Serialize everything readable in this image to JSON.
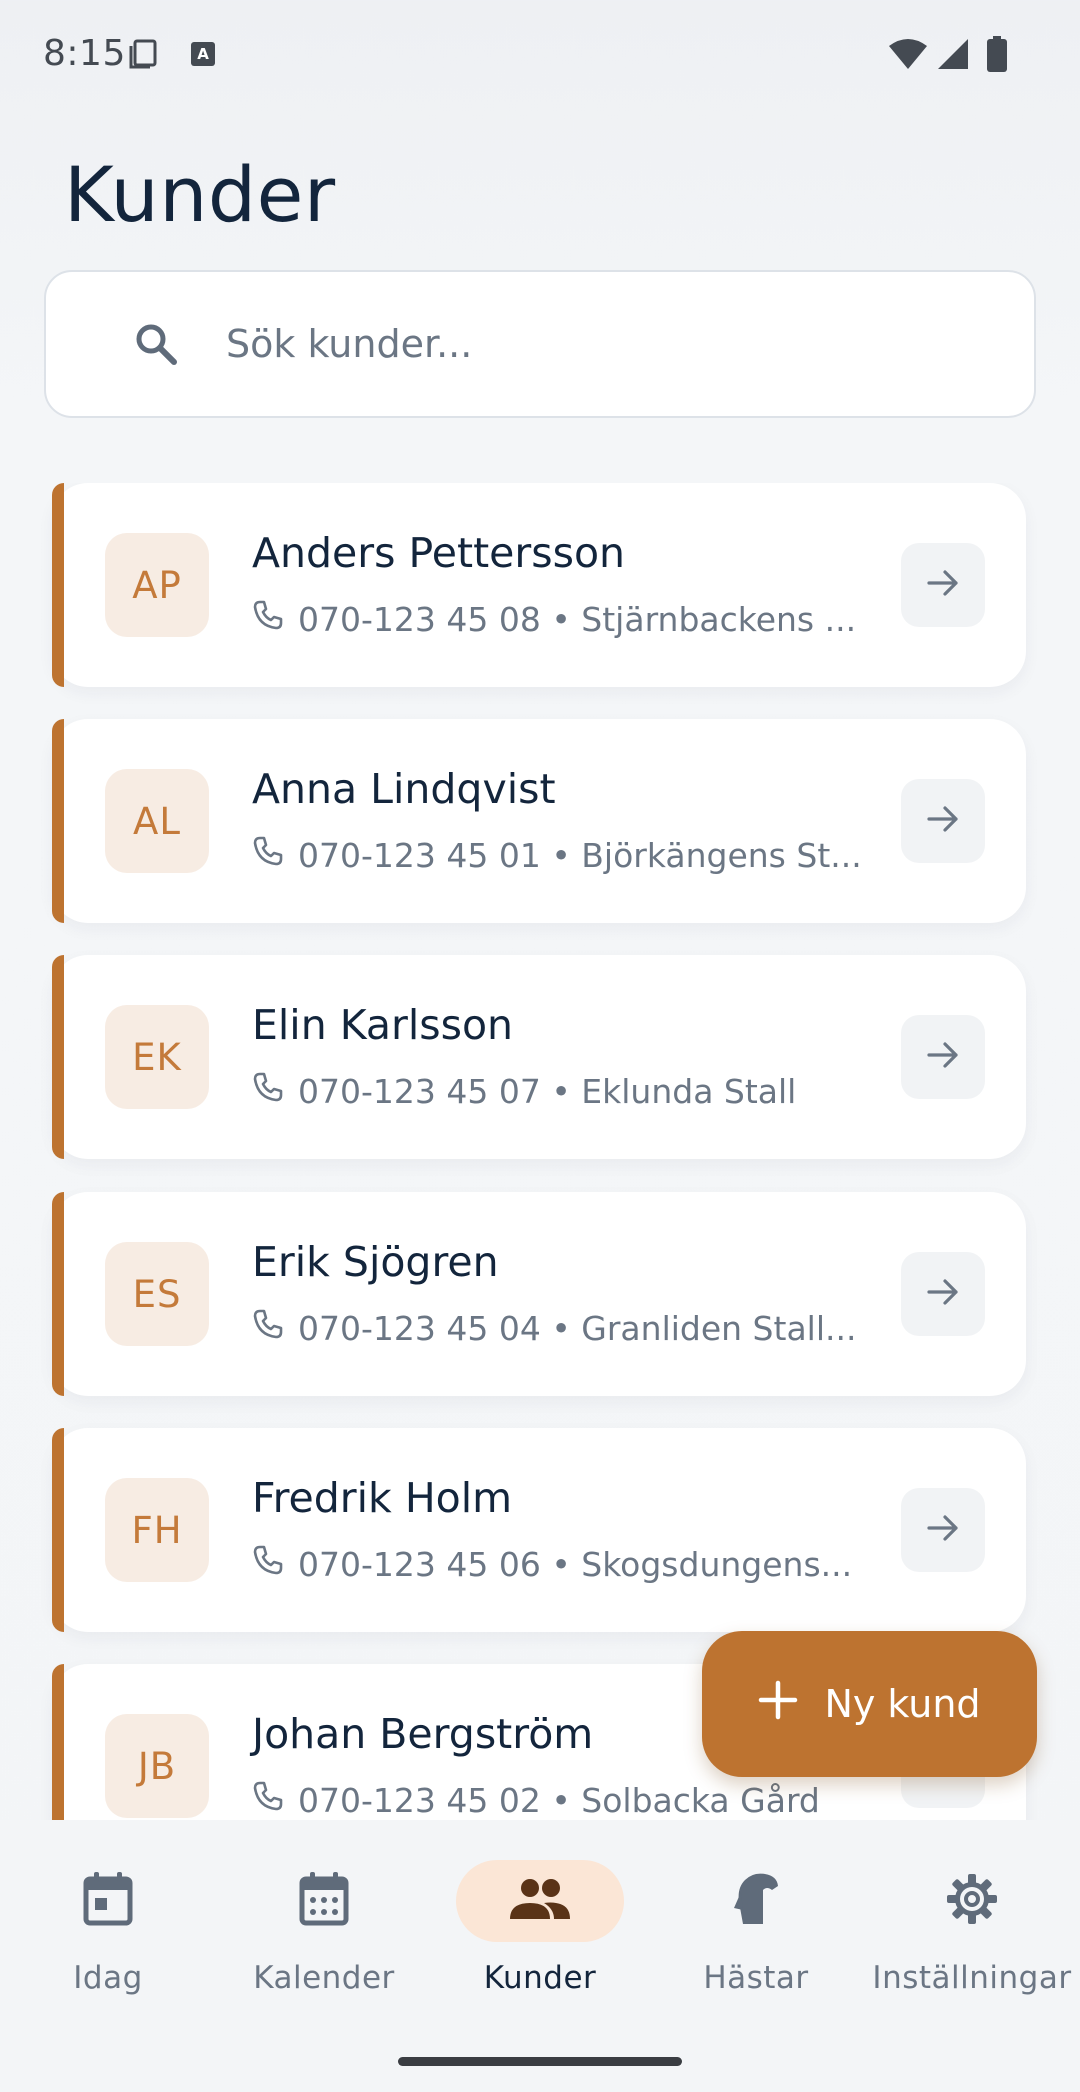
{
  "status_bar": {
    "time": "8:15"
  },
  "header": {
    "title": "Kunder"
  },
  "search": {
    "placeholder": "Sök kunder..."
  },
  "customers": [
    {
      "initials": "AP",
      "name": "Anders Pettersson",
      "meta": "070-123 45 08 • Stjärnbackens ..."
    },
    {
      "initials": "AL",
      "name": "Anna Lindqvist",
      "meta": "070-123 45 01 • Björkängens St..."
    },
    {
      "initials": "EK",
      "name": "Elin Karlsson",
      "meta": "070-123 45 07 • Eklunda Stall"
    },
    {
      "initials": "ES",
      "name": "Erik Sjögren",
      "meta": "070-123 45 04 • Granliden Stall..."
    },
    {
      "initials": "FH",
      "name": "Fredrik Holm",
      "meta": "070-123 45 06 • Skogsdungens..."
    },
    {
      "initials": "JB",
      "name": "Johan Bergström",
      "meta": "070-123 45 02 • Solbacka Gård"
    }
  ],
  "fab": {
    "label": "Ny kund"
  },
  "bottom_nav": {
    "items": [
      {
        "label": "Idag",
        "icon": "calendar-today-icon"
      },
      {
        "label": "Kalender",
        "icon": "calendar-month-icon"
      },
      {
        "label": "Kunder",
        "icon": "people-icon",
        "active": true
      },
      {
        "label": "Hästar",
        "icon": "horse-icon"
      },
      {
        "label": "Inställningar",
        "icon": "gear-icon"
      }
    ]
  },
  "colors": {
    "accent": "#bd7330",
    "avatar_bg": "#f7ece3",
    "avatar_text": "#c47a3a",
    "title_text": "#13253c",
    "muted_text": "#6b7684",
    "nav_active_bg": "#fbe6d6"
  }
}
